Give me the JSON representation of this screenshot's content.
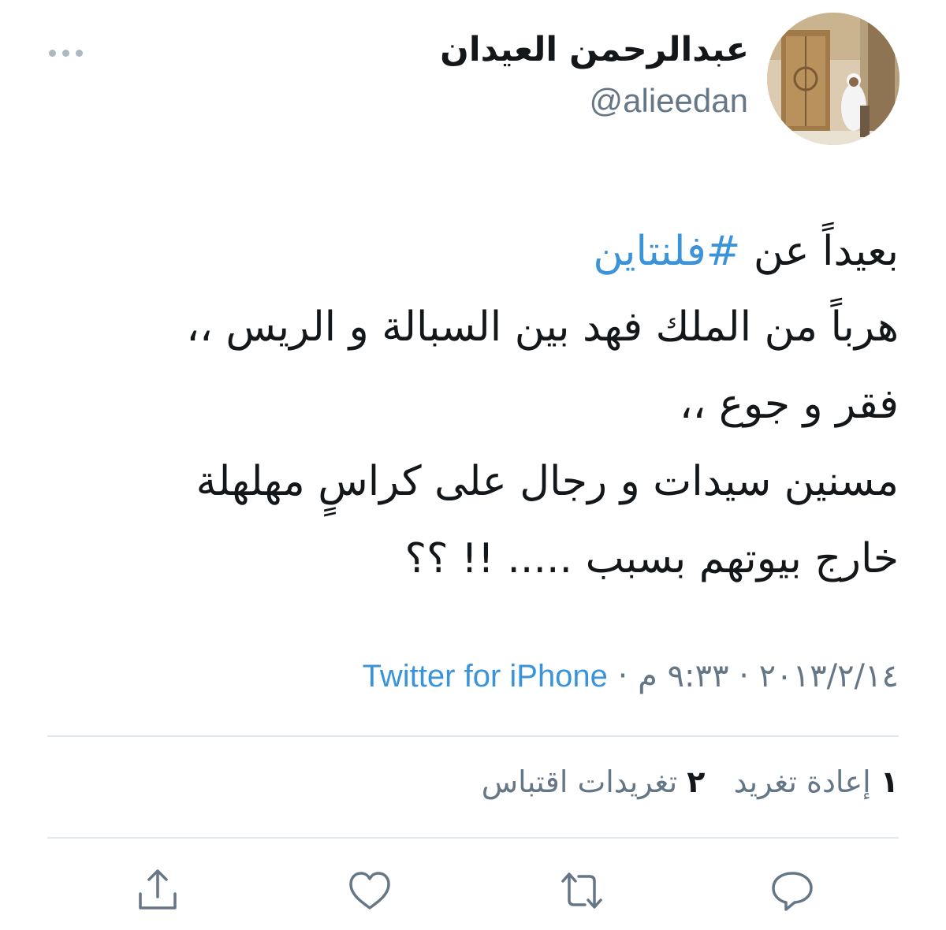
{
  "author": {
    "display_name": "عبدالرحمن العيدان",
    "handle": "@alieedan",
    "avatar_icon": "profile-photo"
  },
  "tweet": {
    "line1_prefix": "بعيداً عن ",
    "hashtag": "#فلنتاين",
    "line2": "هرباً من الملك فهد بين السبالة و الريس ،،",
    "line3": "فقر و جوع ،،",
    "line4": "مسنين سيدات و رجال على كراسٍ مهلهلة",
    "line5": "خارج بيوتهم بسبب ..... !! ؟؟"
  },
  "meta": {
    "date": "٢٠١٣/٢/١٤",
    "separator": "·",
    "time": "٩:٣٣ م",
    "source": "Twitter for iPhone"
  },
  "stats": {
    "retweets_count": "١",
    "retweets_label": "إعادة تغريد",
    "quotes_count": "٢",
    "quotes_label": "تغريدات اقتباس"
  },
  "actions": {
    "reply_icon": "reply-icon",
    "retweet_icon": "retweet-icon",
    "like_icon": "heart-icon",
    "share_icon": "share-icon"
  },
  "colors": {
    "link": "#3b94d9",
    "secondary_text": "#657786",
    "icon": "#657786",
    "divider": "#e1e8ed"
  }
}
